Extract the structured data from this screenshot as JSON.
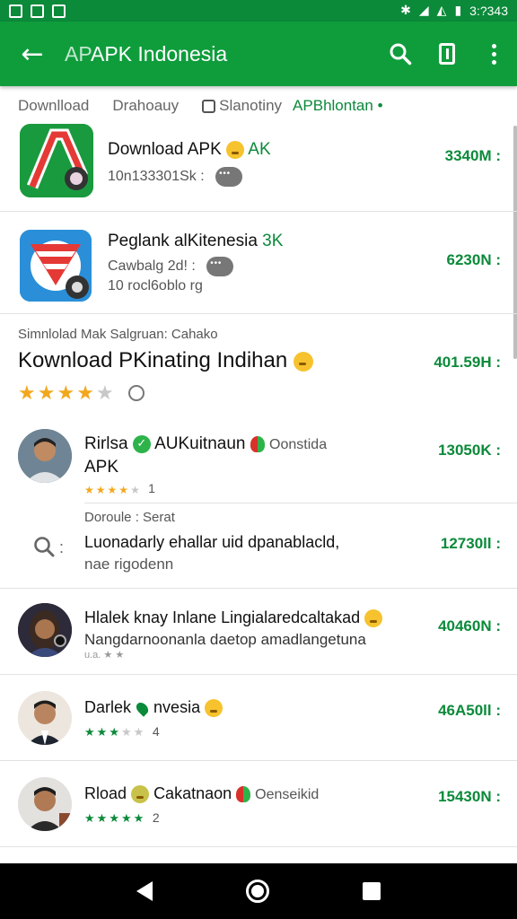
{
  "status_bar": {
    "time": "3:?343",
    "icons": [
      "image-icon",
      "mail-icon",
      "message-icon",
      "bluetooth-icon",
      "signal-icon",
      "wifi-icon",
      "battery-icon"
    ]
  },
  "app_bar": {
    "back_icon": "arrow-left-icon",
    "title_prefix": "AP",
    "title": "APK Indonesia",
    "actions": [
      "search-icon",
      "card-icon",
      "more-vert-icon"
    ]
  },
  "filters": {
    "items": [
      "Downlload",
      "Drahoauy",
      "Slanotiny",
      "APBhlontan"
    ],
    "active_suffix": "•"
  },
  "rows": [
    {
      "title": "Download APK",
      "tag": "AK",
      "subtitle": "10n133301Sk :",
      "right": "3340M :"
    },
    {
      "title": "Peglank alKitenesia",
      "tag": "3K",
      "subtitle": "Cawbalg 2d! :",
      "subtitle2": "10 rocl6oblo rg",
      "right": "6230N :"
    }
  ],
  "section": {
    "caption": "Simnlolad Mak Salgruan: Cahako",
    "title": "Kownload PKinating Indihan",
    "right": "401.59H :",
    "stars_filled": 4,
    "stars_total": 5
  },
  "reviews": [
    {
      "name": "Rirlsa",
      "app": "AUKuitnaun",
      "extra": "Oonstida",
      "line2": "APK",
      "stars_filled": 4,
      "stars_total": 5,
      "count": "1",
      "right": "13050K :"
    },
    {
      "label": "Doroule : Serat",
      "body": "Luonadarly ehallar uid dpanablacld,",
      "body2": "nae rigodenn",
      "right": "12730ll :"
    },
    {
      "name": "Hlalek knay Inlane Lingialaredcaltakad",
      "body": "Nangdarnoonanla daetop amadlangetuna",
      "body2": "u.a. ★ ★",
      "right": "40460N :"
    },
    {
      "name": "Darlek",
      "app": "nvesia",
      "stars_filled": 3,
      "stars_total": 5,
      "count": "4",
      "right": "46A50ll :"
    },
    {
      "name": "Rload",
      "app": "Cakatnaon",
      "extra": "Oenseikid",
      "stars_filled": 5,
      "stars_total": 5,
      "count": "2",
      "right": "15430N :"
    }
  ],
  "colors": {
    "primary": "#0f9d3c",
    "status": "#0b8a3a",
    "accent_text": "#0b8a3a",
    "star": "#f2a81d"
  }
}
